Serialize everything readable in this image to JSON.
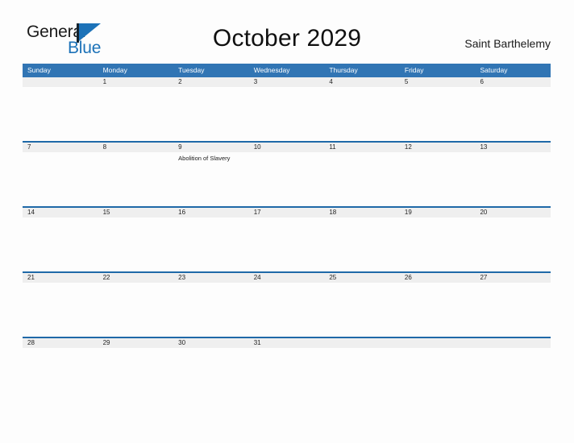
{
  "brand": {
    "name_part1": "General",
    "name_part2": "Blue",
    "flag_icon": "flag-icon"
  },
  "header": {
    "title": "October 2029",
    "region": "Saint Barthelemy"
  },
  "calendar": {
    "month": "October",
    "year": "2029",
    "day_headers": [
      "Sunday",
      "Monday",
      "Tuesday",
      "Wednesday",
      "Thursday",
      "Friday",
      "Saturday"
    ],
    "colors": {
      "header_blue": "#3175b4",
      "row_rule_blue": "#1f69a8",
      "number_band_gray": "#efefef",
      "brand_blue": "#1c72b8",
      "page_background": "#fdfdfd"
    },
    "weeks": [
      {
        "days": [
          {
            "number": "",
            "events": []
          },
          {
            "number": "1",
            "events": []
          },
          {
            "number": "2",
            "events": []
          },
          {
            "number": "3",
            "events": []
          },
          {
            "number": "4",
            "events": []
          },
          {
            "number": "5",
            "events": []
          },
          {
            "number": "6",
            "events": []
          }
        ]
      },
      {
        "days": [
          {
            "number": "7",
            "events": []
          },
          {
            "number": "8",
            "events": []
          },
          {
            "number": "9",
            "events": [
              "Abolition of Slavery"
            ]
          },
          {
            "number": "10",
            "events": []
          },
          {
            "number": "11",
            "events": []
          },
          {
            "number": "12",
            "events": []
          },
          {
            "number": "13",
            "events": []
          }
        ]
      },
      {
        "days": [
          {
            "number": "14",
            "events": []
          },
          {
            "number": "15",
            "events": []
          },
          {
            "number": "16",
            "events": []
          },
          {
            "number": "17",
            "events": []
          },
          {
            "number": "18",
            "events": []
          },
          {
            "number": "19",
            "events": []
          },
          {
            "number": "20",
            "events": []
          }
        ]
      },
      {
        "days": [
          {
            "number": "21",
            "events": []
          },
          {
            "number": "22",
            "events": []
          },
          {
            "number": "23",
            "events": []
          },
          {
            "number": "24",
            "events": []
          },
          {
            "number": "25",
            "events": []
          },
          {
            "number": "26",
            "events": []
          },
          {
            "number": "27",
            "events": []
          }
        ]
      },
      {
        "days": [
          {
            "number": "28",
            "events": []
          },
          {
            "number": "29",
            "events": []
          },
          {
            "number": "30",
            "events": []
          },
          {
            "number": "31",
            "events": []
          },
          {
            "number": "",
            "events": []
          },
          {
            "number": "",
            "events": []
          },
          {
            "number": "",
            "events": []
          }
        ]
      }
    ]
  }
}
